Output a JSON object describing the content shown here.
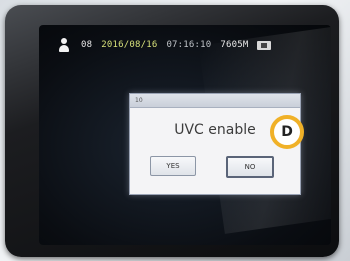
{
  "status_bar": {
    "user_icon": "person-icon",
    "counter": "08",
    "date": "2016/08/16",
    "time": "07:16:10",
    "remaining": "7605M",
    "storage_icon": "sd-card-icon"
  },
  "dialog": {
    "title": "10",
    "message": "UVC enable",
    "yes_label": "YES",
    "no_label": "NO",
    "selected": "NO"
  },
  "callout": {
    "label": "D"
  },
  "colors": {
    "marker_ring": "#f0b128",
    "date_text": "#d6e07a"
  }
}
